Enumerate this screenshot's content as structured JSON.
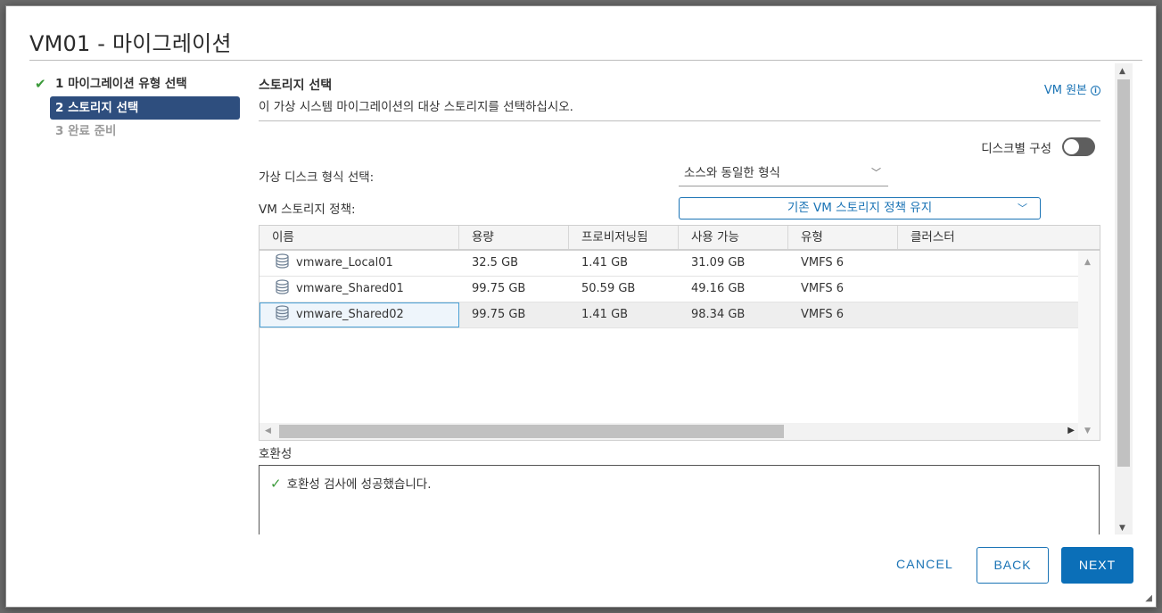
{
  "dialog": {
    "title": "VM01 - 마이그레이션"
  },
  "steps": [
    {
      "label": "1 마이그레이션 유형 선택",
      "state": "done"
    },
    {
      "label": "2 스토리지 선택",
      "state": "current"
    },
    {
      "label": "3 완료 준비",
      "state": "future"
    }
  ],
  "section": {
    "title": "스토리지 선택",
    "description": "이 가상 시스템 마이그레이션의 대상 스토리지를 선택하십시오.",
    "vm_origin_link": "VM 원본"
  },
  "per_disk": {
    "label": "디스크별 구성",
    "enabled": false
  },
  "disk_format": {
    "label": "가상 디스크 형식 선택:",
    "value": "소스와 동일한 형식"
  },
  "storage_policy": {
    "label": "VM 스토리지 정책:",
    "value": "기존 VM 스토리지 정책 유지"
  },
  "table": {
    "columns": [
      "이름",
      "용량",
      "프로비저닝됨",
      "사용 가능",
      "유형",
      "클러스터"
    ],
    "rows": [
      {
        "name": "vmware_Local01",
        "capacity": "32.5 GB",
        "provisioned": "1.41 GB",
        "free": "31.09 GB",
        "type": "VMFS 6",
        "cluster": ""
      },
      {
        "name": "vmware_Shared01",
        "capacity": "99.75 GB",
        "provisioned": "50.59 GB",
        "free": "49.16 GB",
        "type": "VMFS 6",
        "cluster": ""
      },
      {
        "name": "vmware_Shared02",
        "capacity": "99.75 GB",
        "provisioned": "1.41 GB",
        "free": "98.34 GB",
        "type": "VMFS 6",
        "cluster": "",
        "selected": true
      }
    ]
  },
  "compatibility": {
    "label": "호환성",
    "message": "호환성 검사에 성공했습니다."
  },
  "buttons": {
    "cancel": "CANCEL",
    "back": "BACK",
    "next": "NEXT"
  },
  "icons": {
    "check": "check-icon",
    "info": "info-icon",
    "datastore": "datastore-icon",
    "chevron": "chevron-down-icon"
  },
  "colors": {
    "accent": "#1a73b5",
    "step_active_bg": "#2e4e7e",
    "success": "#3b9a3a",
    "primary_button": "#0b6fb8"
  }
}
